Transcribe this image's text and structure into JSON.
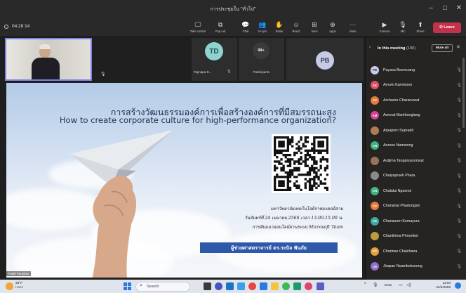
{
  "window": {
    "title": "การประชุมใน \"ทั่วไป\"",
    "controls": [
      "–",
      "□",
      "✕"
    ]
  },
  "toolbar": {
    "timer": "04:28:14",
    "buttons": [
      {
        "label": "Take control",
        "icon": "take-control-icon",
        "glyph": "🖵"
      },
      {
        "label": "Pop out",
        "icon": "pop-out-icon",
        "glyph": "⧉"
      },
      {
        "label": "Chat",
        "icon": "chat-icon",
        "glyph": "💬"
      },
      {
        "label": "People",
        "icon": "people-icon",
        "glyph": "👥",
        "active": true
      },
      {
        "label": "Raise",
        "icon": "raise-hand-icon",
        "glyph": "✋"
      },
      {
        "label": "React",
        "icon": "react-icon",
        "glyph": "☺"
      },
      {
        "label": "View",
        "icon": "view-icon",
        "glyph": "⊞"
      },
      {
        "label": "Apps",
        "icon": "apps-icon",
        "glyph": "⊕"
      },
      {
        "label": "More",
        "icon": "more-icon",
        "glyph": "···"
      }
    ],
    "devices": [
      {
        "label": "Camera",
        "icon": "camera-off-icon",
        "glyph": "▶"
      },
      {
        "label": "Mic",
        "icon": "mic-off-icon",
        "glyph": "🎙"
      },
      {
        "label": "Share",
        "icon": "share-icon",
        "glyph": "⬆"
      }
    ],
    "leave_label": "Leave"
  },
  "tiles": {
    "video_name": "",
    "td": {
      "initials": "TD",
      "name": "Tepnapa D...",
      "color": "#8fd3ce"
    },
    "count": {
      "label": "99+",
      "caption": "Participants"
    },
    "pb": {
      "initials": "PB",
      "color": "#c5cae9"
    }
  },
  "slide": {
    "title_th": "การสร้างวัฒนธรรมองค์การเพื่อสร้างองค์การที่มีสมรรถนะสูง",
    "title_en": "How to create corporate culture for high-performance organization?",
    "university": "มหาวิทยาลัยเทคโนโลยีราชมงคลอีสาน",
    "date": "วันจันทร์ที่ 24 เมษายน 2566 เวลา 13.00-15.00 น.",
    "format": "การสัมมนาออนไลน์ผ่านระบบ Microsoft Team",
    "presenter": "ผู้ช่วยศาสตราจารย์ ดร.ระบิล พันภัย",
    "sharer": "Rabil Panphai"
  },
  "panel": {
    "title": "In this meeting",
    "count": "(190)",
    "mute_all": "Mute all",
    "participants": [
      {
        "initials": "PB",
        "name": "Payasa Boonruang",
        "color": "#c5cae9",
        "text": "#333"
      },
      {
        "initials": "AK",
        "name": "Amorn Kammoon",
        "color": "#e05263",
        "text": "#fff"
      },
      {
        "initials": "AC",
        "name": "Archaree Charanuwat",
        "color": "#e67a3a",
        "text": "#fff"
      },
      {
        "initials": "AM",
        "name": "Areerat Manthonglang",
        "color": "#d1468e",
        "text": "#fff"
      },
      {
        "initials": "",
        "name": "Arpaporn Supradit",
        "color": "#b07b52",
        "text": "#fff"
      },
      {
        "initials": "AN",
        "name": "Arunee Namwong",
        "color": "#3fb37f",
        "text": "#fff"
      },
      {
        "initials": "",
        "name": "Autjima Tanganusornsuk",
        "color": "#9a7257",
        "text": "#fff"
      },
      {
        "initials": "",
        "name": "Chaiyapruek Phara",
        "color": "#8a8a8a",
        "text": "#fff"
      },
      {
        "initials": "CN",
        "name": "Chalalai Ngaonoi",
        "color": "#3fb37f",
        "text": "#fff"
      },
      {
        "initials": "CP",
        "name": "Chananat Phadungsin",
        "color": "#e67a3a",
        "text": "#fff"
      },
      {
        "initials": "CK",
        "name": "Chanasorn Kemayura",
        "color": "#3fa89f",
        "text": "#fff"
      },
      {
        "initials": "",
        "name": "Chanthima Phromket",
        "color": "#b89b3c",
        "text": "#fff"
      },
      {
        "initials": "CC",
        "name": "Charinee Chaichana",
        "color": "#e2a03a",
        "text": "#fff"
      },
      {
        "initials": "JN",
        "name": "Jirapan Nuamkoksoong",
        "color": "#8c6fc7",
        "text": "#fff"
      }
    ]
  },
  "taskbar": {
    "weather_temp": "33°F",
    "weather_desc": "Haze",
    "search_placeholder": "Search",
    "lang": "ENG",
    "time": "13:00",
    "date": "24/4/2566"
  }
}
